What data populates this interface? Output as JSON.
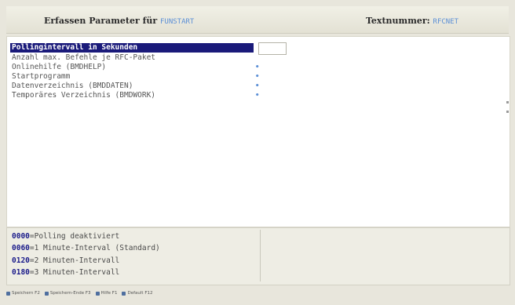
{
  "header": {
    "title_prefix": "Erfassen Parameter für",
    "program": "FUNSTART",
    "text_label": "Textnummer:",
    "text_number": "RFCNET"
  },
  "main": {
    "rows": [
      {
        "label": "Pollingintervall in Sekunden",
        "marker": ""
      },
      {
        "label": "Anzahl max. Befehle je RFC-Paket",
        "marker": ""
      },
      {
        "label": "Onlinehilfe (BMDHELP)",
        "marker": "•"
      },
      {
        "label": "Startprogramm",
        "marker": "•"
      },
      {
        "label": "Datenverzeichnis (BMDDATEN)",
        "marker": "•"
      },
      {
        "label": "Temporäres Verzeichnis (BMDWORK)",
        "marker": "•"
      }
    ],
    "selected_index": 0,
    "value": ""
  },
  "help": {
    "lines": [
      {
        "code": "0000",
        "text": "=Polling deaktiviert"
      },
      {
        "code": "0060",
        "text": "=1 Minute-Interval (Standard)"
      },
      {
        "code": "0120",
        "text": "=2 Minuten-Intervall"
      },
      {
        "code": "0180",
        "text": "=3 Minuten-Intervall"
      }
    ]
  },
  "statusbar": {
    "items": [
      {
        "icon": "save-icon",
        "label": "Speichern F2"
      },
      {
        "icon": "save-close-icon",
        "label": "Speichern-Ende F3"
      },
      {
        "icon": "help-icon",
        "label": "Hilfe F1"
      },
      {
        "icon": "default-icon",
        "label": "Default F12"
      }
    ]
  }
}
